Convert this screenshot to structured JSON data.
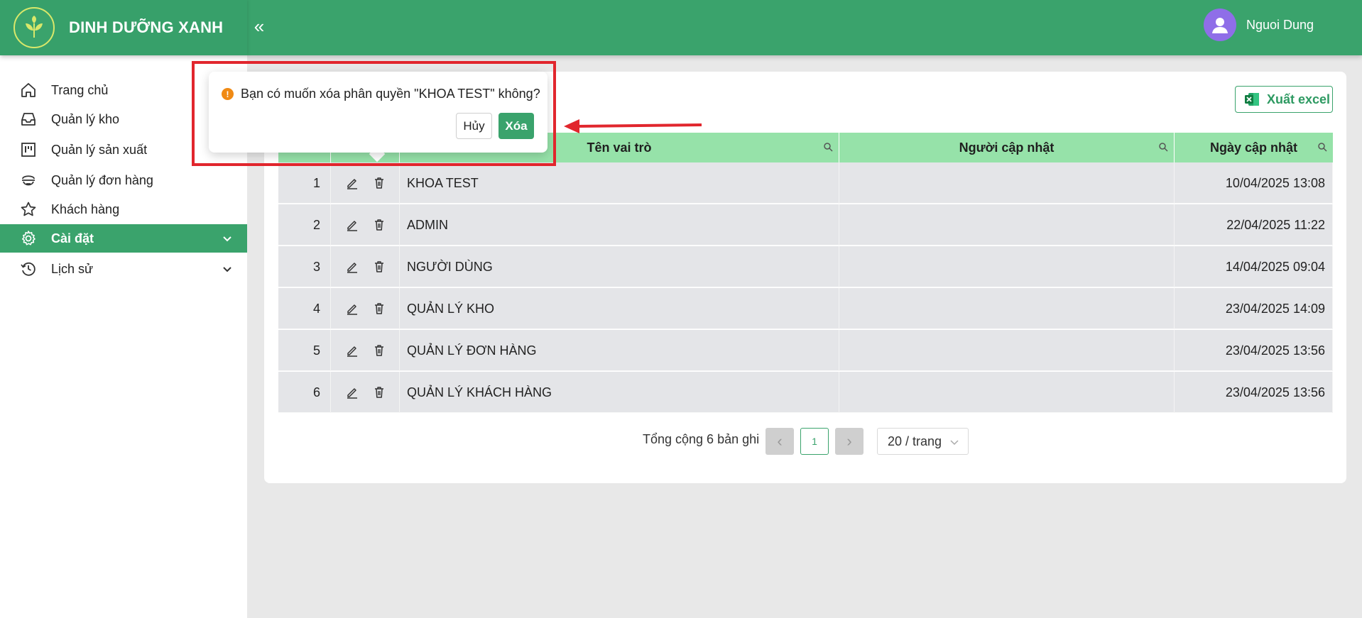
{
  "app": {
    "brand_title": "DINH DƯỠNG XANH",
    "user_name": "Nguoi Dung",
    "collapse_glyph": "«"
  },
  "colors": {
    "primary": "#3aa36c",
    "table_header": "#96e2a9",
    "row_bg": "#e4e5e8",
    "annotation_red": "#e1262d",
    "warning": "#f08a14"
  },
  "sidebar": {
    "items": [
      {
        "label": "Trang chủ",
        "icon": "home-icon"
      },
      {
        "label": "Quản lý kho",
        "icon": "inbox-icon"
      },
      {
        "label": "Quản lý sản xuất",
        "icon": "project-board-icon"
      },
      {
        "label": "Quản lý đơn hàng",
        "icon": "truck-icon"
      },
      {
        "label": "Khách hàng",
        "icon": "star-icon"
      },
      {
        "label": "Cài đặt",
        "icon": "gear-icon",
        "active": true,
        "expandable": true
      },
      {
        "label": "Lịch sử",
        "icon": "history-clock-icon",
        "expandable": true
      }
    ]
  },
  "toolbar": {
    "export_label": "Xuất excel"
  },
  "table": {
    "columns": [
      "Tên vai trò",
      "Người cập nhật",
      "Ngày cập nhật"
    ],
    "rows": [
      {
        "idx": "1",
        "name": "KHOA TEST",
        "updated_by": "",
        "updated_at": "10/04/2025 13:08"
      },
      {
        "idx": "2",
        "name": "ADMIN",
        "updated_by": "",
        "updated_at": "22/04/2025 11:22"
      },
      {
        "idx": "3",
        "name": "NGƯỜI DÙNG",
        "updated_by": "",
        "updated_at": "14/04/2025 09:04"
      },
      {
        "idx": "4",
        "name": "QUẢN LÝ KHO",
        "updated_by": "",
        "updated_at": "23/04/2025 14:09"
      },
      {
        "idx": "5",
        "name": "QUẢN LÝ ĐƠN HÀNG",
        "updated_by": "",
        "updated_at": "23/04/2025 13:56"
      },
      {
        "idx": "6",
        "name": "QUẢN LÝ KHÁCH HÀNG",
        "updated_by": "",
        "updated_at": "23/04/2025 13:56"
      }
    ]
  },
  "pagination": {
    "total_text": "Tổng cộng 6 bản ghi",
    "current_page": "1",
    "page_size_label": "20 / trang",
    "prev_glyph": "‹",
    "next_glyph": "›"
  },
  "popconfirm": {
    "icon_glyph": "!",
    "message": "Bạn có muốn xóa phân quyền \"KHOA TEST\" không?",
    "cancel_label": "Hủy",
    "ok_label": "Xóa"
  }
}
